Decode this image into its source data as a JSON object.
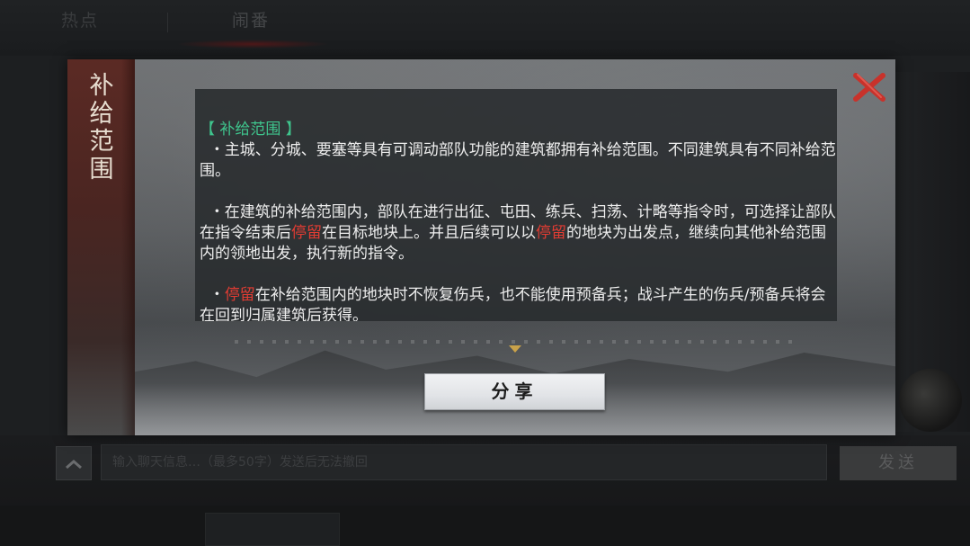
{
  "background": {
    "tabs": [
      "热点",
      "闹番"
    ],
    "chat_placeholder": "输入聊天信息…（最多50字）发送后无法撤回",
    "send_label": "发送"
  },
  "modal": {
    "side_title": [
      "补",
      "给",
      "范",
      "围"
    ],
    "section_title": "【 补给范围 】",
    "paragraphs": [
      [
        "  ・主城、分城、要塞等具有可调动部队功能的建筑都拥有补给范围。不同建筑具有不同补给范围。"
      ],
      [
        "  ・在建筑的补给范围内，部队在进行出征、屯田、练兵、扫荡、计略等指令时，可选择让部队在指令结束后",
        "停留",
        "在目标地块上。并且后续可以以",
        "停留",
        "的地块为出发点，继续向其他补给范围内的领地出发，执行新的指令。"
      ],
      [
        "  ・",
        "停留",
        "在补给范围内的地块时不恢复伤兵，也不能使用预备兵；战斗产生的伤兵/预备兵将会在回到归属建筑后获得。"
      ]
    ],
    "share_label": "分享"
  },
  "colors": {
    "section_title": "#3fc58d",
    "highlight": "#e23c33",
    "close": "#c8322b"
  }
}
